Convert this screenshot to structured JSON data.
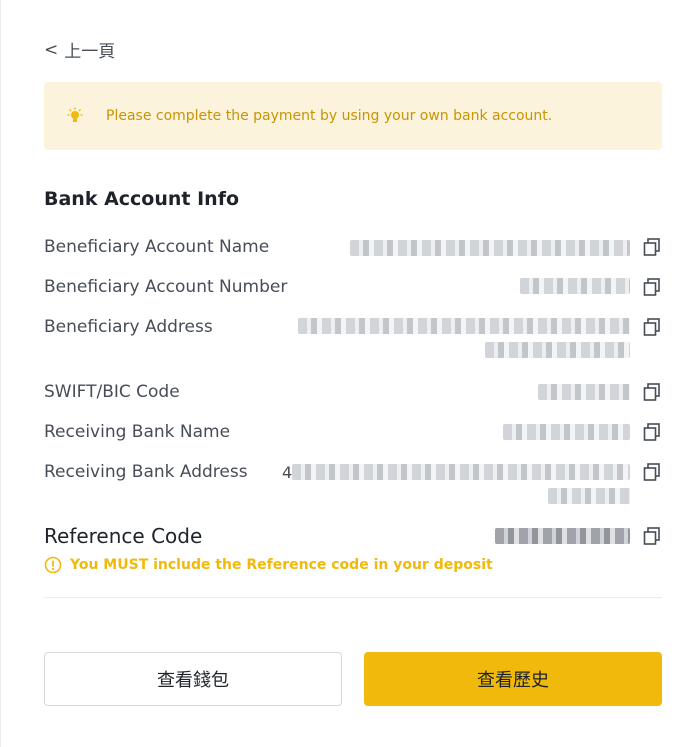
{
  "nav": {
    "back_label": "上一頁",
    "back_icon": "chevron-left-icon"
  },
  "notice": {
    "text": "Please complete the payment by using your own bank account.",
    "icon": "lightbulb-icon",
    "color": "#c99400",
    "background": "#fbf3dc"
  },
  "bank_info": {
    "title": "Bank Account Info",
    "rows": [
      {
        "label": "Beneficiary Account Name",
        "value": ""
      },
      {
        "label": "Beneficiary Account Number",
        "value": ""
      },
      {
        "label": "Beneficiary Address",
        "value": ""
      },
      {
        "label": "SWIFT/BIC Code",
        "value": ""
      },
      {
        "label": "Receiving Bank Name",
        "value": ""
      },
      {
        "label": "Receiving Bank Address",
        "value": "4"
      }
    ],
    "copy_icon": "copy-icon"
  },
  "reference": {
    "title": "Reference Code",
    "warning": "You MUST include the Reference code in your deposit",
    "warning_icon": "warning-circle-icon",
    "warning_color": "#f0b90b"
  },
  "buttons": {
    "wallet_label": "查看錢包",
    "history_label": "查看歷史"
  },
  "colors": {
    "accent": "#f0b90b",
    "text": "#1e2329",
    "muted": "#474d57"
  }
}
